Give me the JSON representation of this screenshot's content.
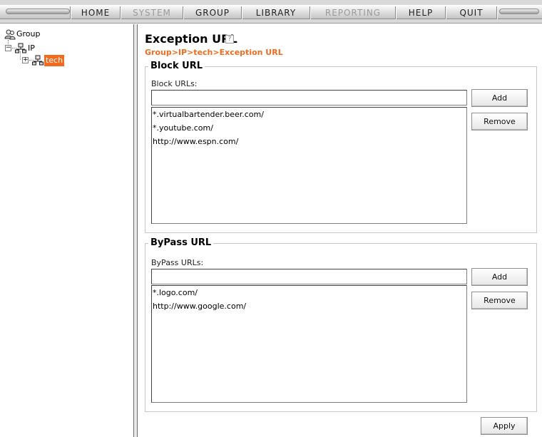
{
  "menu": {
    "items": [
      {
        "label": "HOME",
        "enabled": true
      },
      {
        "label": "SYSTEM",
        "enabled": false
      },
      {
        "label": "GROUP",
        "enabled": true
      },
      {
        "label": "LIBRARY",
        "enabled": true
      },
      {
        "label": "REPORTING",
        "enabled": false
      },
      {
        "label": "HELP",
        "enabled": true
      },
      {
        "label": "QUIT",
        "enabled": true
      }
    ]
  },
  "tree": {
    "root": {
      "label": "Group",
      "icon": "group-users-icon"
    },
    "nodes": [
      {
        "label": "IP",
        "icon": "network-icon",
        "toggle": "⊟"
      },
      {
        "label": "tech",
        "icon": "network-icon",
        "toggle": "⊞",
        "selected": true
      }
    ]
  },
  "page": {
    "title": "Exception URL",
    "help_icon": "?",
    "breadcrumb": "Group>IP>tech>Exception URL"
  },
  "block": {
    "legend": "Block URL",
    "label": "Block URLs:",
    "input_value": "",
    "add_label": "Add",
    "remove_label": "Remove",
    "urls": [
      "*.virtualbartender.beer.com/",
      "*.youtube.com/",
      "http://www.espn.com/"
    ]
  },
  "bypass": {
    "legend": "ByPass URL",
    "label": "ByPass URLs:",
    "input_value": "",
    "add_label": "Add",
    "remove_label": "Remove",
    "urls": [
      "*.logo.com/",
      "http://www.google.com/"
    ]
  },
  "footer": {
    "apply_label": "Apply"
  },
  "colors": {
    "accent": "#f26b1d",
    "disabled_menu": "#9a9a9a"
  }
}
